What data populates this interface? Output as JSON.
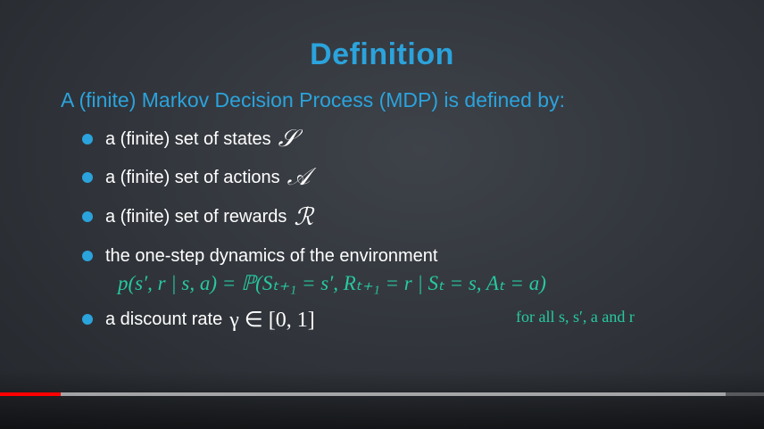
{
  "slide": {
    "title": "Definition",
    "intro": "A (finite) Markov Decision Process (MDP) is defined by:",
    "bullets": [
      {
        "text": "a (finite) set of states",
        "symbol": "𝒮"
      },
      {
        "text": "a (finite) set of actions",
        "symbol": "𝒜"
      },
      {
        "text": "a (finite) set of rewards",
        "symbol": "ℛ"
      },
      {
        "text": "the one-step dynamics of the environment",
        "symbol": ""
      },
      {
        "text": "a discount rate",
        "symbol": "γ ∈ [0, 1]"
      }
    ],
    "dynamics_equation": "p(s′, r | s, a) = ℙ(Sₜ₊₁ = s′, Rₜ₊₁ = r | Sₜ = s, Aₜ = a)",
    "forall_note": "for all s, s′, a and r"
  },
  "player": {
    "progress_played": 0.08,
    "progress_buffered": 0.95,
    "played_color": "#ff0000"
  },
  "colors": {
    "accent": "#2ba3dc",
    "equation": "#27c9a0",
    "background": "#33373d"
  }
}
